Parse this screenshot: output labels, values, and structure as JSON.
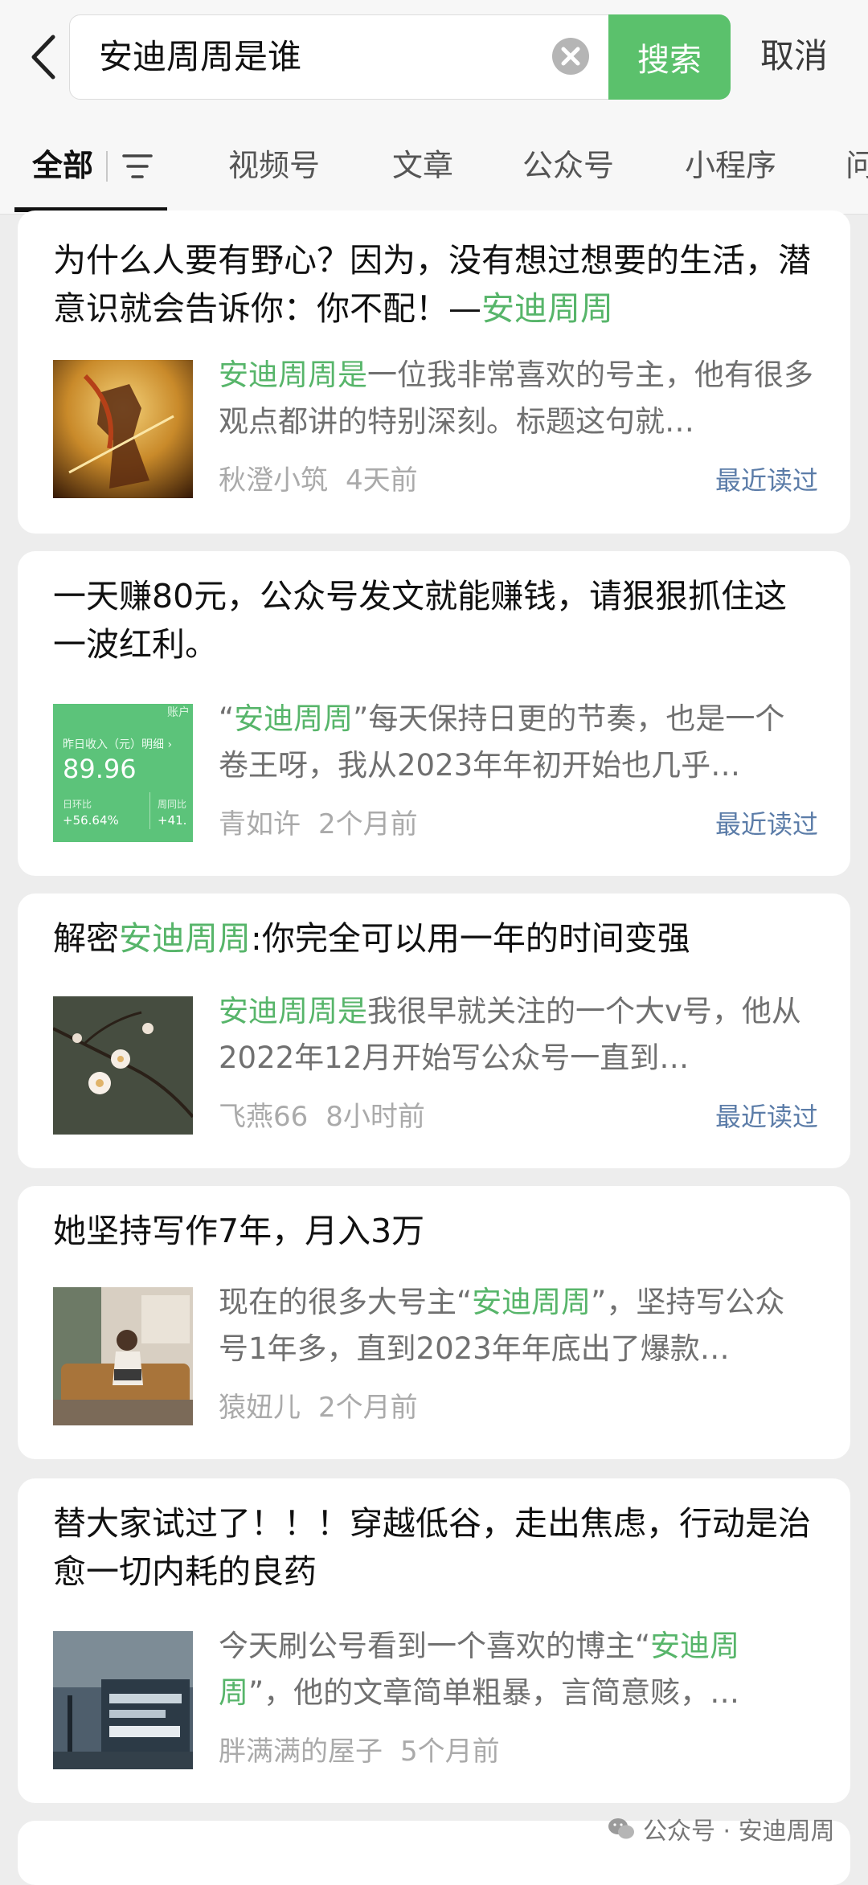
{
  "search": {
    "query": "安迪周周是谁",
    "button_label": "搜索",
    "cancel_label": "取消"
  },
  "tabs": [
    {
      "label": "全部"
    },
    {
      "label": "视频号"
    },
    {
      "label": "文章"
    },
    {
      "label": "公众号"
    },
    {
      "label": "小程序"
    },
    {
      "label": "问"
    }
  ],
  "results": [
    {
      "title_pre": "为什么人要有野心？因为，没有想过想要的生活，潜意识就会告诉你：你不配！—",
      "title_hl": "安迪周周",
      "title_post": "",
      "snippet_pre": "",
      "snippet_hl": "安迪周周是",
      "snippet_post": "一位我非常喜欢的号主，他有很多观点都讲的特别深刻。标题这句就…",
      "source": "秋澄小筑",
      "time": "4天前",
      "badge": "最近读过",
      "thumb_icon": "anime-warrior-image"
    },
    {
      "title_pre": "一天赚80元，公众号发文就能赚钱，请狠狠抓住这一波红利。",
      "title_hl": "",
      "title_post": "",
      "snippet_pre": "“",
      "snippet_hl": "安迪周周",
      "snippet_post": "”每天保持日更的节奏，也是一个卷王呀，我从2023年年初开始也几乎…",
      "source": "青如许",
      "time": "2个月前",
      "badge": "最近读过",
      "thumb_icon": "income-screenshot-image",
      "thumb_text": {
        "header": "账户",
        "label": "昨日收入（元）明细 ›",
        "amount": "89.96",
        "sub1": "日环比",
        "sub1_val": "+56.64%",
        "sub2": "周同比",
        "sub2_val": "+41."
      }
    },
    {
      "title_pre": "解密",
      "title_hl": "安迪周周",
      "title_post": ":你完全可以用一年的时间变强",
      "snippet_pre": "",
      "snippet_hl": "安迪周周是",
      "snippet_post": "我很早就关注的一个大v号，他从2022年12月开始写公众号一直到…",
      "source": "飞燕66",
      "time": "8小时前",
      "badge": "最近读过",
      "thumb_icon": "plum-blossom-image"
    },
    {
      "title_pre": "她坚持写作7年，月入3万",
      "title_hl": "",
      "title_post": "",
      "snippet_pre": "现在的很多大号主“",
      "snippet_hl": "安迪周周",
      "snippet_post": "”，坚持写公众号1年多，直到2023年年底出了爆款…",
      "source": "猿妞儿",
      "time": "2个月前",
      "badge": "",
      "thumb_icon": "woman-on-sofa-image"
    },
    {
      "title_pre": "替大家试过了！！！穿越低谷，走出焦虑，行动是治愈一切内耗的良药",
      "title_hl": "",
      "title_post": "",
      "snippet_pre": "今天刷公号看到一个喜欢的博主“",
      "snippet_hl": "安迪周周",
      "snippet_post": "”，他的文章简单粗暴，言简意赅，…",
      "source": "胖满满的屋子",
      "time": "5个月前",
      "badge": "",
      "thumb_icon": "street-poster-image"
    }
  ],
  "watermark": "公众号 · 安迪周周",
  "colors": {
    "accent": "#57b56a",
    "button": "#5bc16c",
    "link": "#5b7ca8"
  }
}
